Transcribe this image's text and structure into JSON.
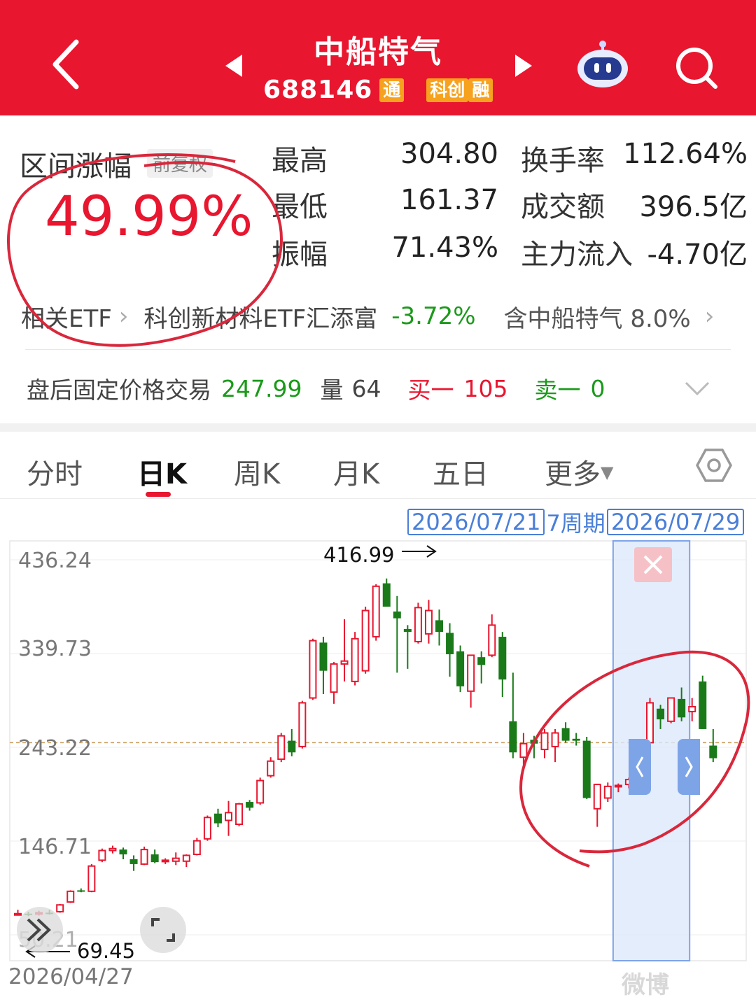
{
  "header": {
    "title": "中船特气",
    "code": "688146",
    "badges": [
      "通",
      "科创",
      "融"
    ]
  },
  "stats": {
    "range_label": "区间涨幅",
    "range_adjust": "前复权",
    "range_value": "49.99%",
    "items": [
      {
        "label": "最高",
        "value": "304.80"
      },
      {
        "label": "最低",
        "value": "161.37"
      },
      {
        "label": "振幅",
        "value": "71.43%"
      },
      {
        "label": "换手率",
        "value": "112.64%"
      },
      {
        "label": "成交额",
        "value": "396.5亿"
      },
      {
        "label": "主力流入",
        "value": "-4.70亿"
      }
    ]
  },
  "etf": {
    "label": "相关ETF",
    "name": "科创新材料ETF汇添富",
    "change": "-3.72%",
    "holding": "含中船特气 8.0%"
  },
  "after_hours": {
    "label": "盘后固定价格交易",
    "price": "247.99",
    "volume_label": "量",
    "volume": "64",
    "bid_label": "买一",
    "bid": "105",
    "ask_label": "卖一",
    "ask": "0"
  },
  "tabs": [
    "分时",
    "日K",
    "周K",
    "月K",
    "五日",
    "更多"
  ],
  "active_tab": "日K",
  "chart_period": {
    "start": "2026/07/21",
    "label": "7周期",
    "end": "2026/07/29"
  },
  "colors": {
    "up": "#e8162f",
    "down": "#1a7a1a",
    "header": "#e8162f",
    "highlight": "#dce8fb"
  },
  "chart_data": {
    "type": "candlestick",
    "y_ticks": [
      "436.24",
      "339.73",
      "243.22",
      "146.71",
      "50.21"
    ],
    "ylim": [
      50.21,
      436.24
    ],
    "start_date": "2026/04/27",
    "max_label": "416.99",
    "min_label": "69.45",
    "reference_line": 247.99,
    "highlight_range": [
      57,
      63
    ],
    "candles": [
      {
        "o": 72,
        "h": 76,
        "l": 70,
        "c": 72
      },
      {
        "o": 72,
        "h": 74,
        "l": 69.45,
        "c": 71
      },
      {
        "o": 72,
        "h": 75,
        "l": 70,
        "c": 73
      },
      {
        "o": 73,
        "h": 76,
        "l": 71,
        "c": 72
      },
      {
        "o": 74,
        "h": 82,
        "l": 73,
        "c": 81
      },
      {
        "o": 84,
        "h": 96,
        "l": 83,
        "c": 95
      },
      {
        "o": 96,
        "h": 98,
        "l": 94,
        "c": 95
      },
      {
        "o": 95,
        "h": 123,
        "l": 94,
        "c": 121
      },
      {
        "o": 127,
        "h": 139,
        "l": 125,
        "c": 137
      },
      {
        "o": 137,
        "h": 142,
        "l": 134,
        "c": 139
      },
      {
        "o": 138,
        "h": 140,
        "l": 128,
        "c": 133
      },
      {
        "o": 128,
        "h": 132,
        "l": 116,
        "c": 123
      },
      {
        "o": 123,
        "h": 141,
        "l": 122,
        "c": 138
      },
      {
        "o": 133,
        "h": 138,
        "l": 124,
        "c": 125
      },
      {
        "o": 126,
        "h": 129,
        "l": 123,
        "c": 127
      },
      {
        "o": 126,
        "h": 135,
        "l": 122,
        "c": 129
      },
      {
        "o": 126,
        "h": 133,
        "l": 120,
        "c": 132
      },
      {
        "o": 133,
        "h": 150,
        "l": 132,
        "c": 147
      },
      {
        "o": 149,
        "h": 173,
        "l": 147,
        "c": 171
      },
      {
        "o": 175,
        "h": 180,
        "l": 161,
        "c": 165
      },
      {
        "o": 168,
        "h": 188,
        "l": 152,
        "c": 176
      },
      {
        "o": 164,
        "h": 186,
        "l": 162,
        "c": 185
      },
      {
        "o": 187,
        "h": 189,
        "l": 178,
        "c": 181
      },
      {
        "o": 186,
        "h": 212,
        "l": 184,
        "c": 209
      },
      {
        "o": 214,
        "h": 233,
        "l": 212,
        "c": 229
      },
      {
        "o": 231,
        "h": 258,
        "l": 228,
        "c": 255
      },
      {
        "o": 250,
        "h": 262,
        "l": 234,
        "c": 238
      },
      {
        "o": 244,
        "h": 291,
        "l": 242,
        "c": 289
      },
      {
        "o": 294,
        "h": 355,
        "l": 292,
        "c": 353
      },
      {
        "o": 351,
        "h": 357,
        "l": 298,
        "c": 322
      },
      {
        "o": 300,
        "h": 331,
        "l": 288,
        "c": 329
      },
      {
        "o": 329,
        "h": 375,
        "l": 311,
        "c": 332
      },
      {
        "o": 311,
        "h": 362,
        "l": 307,
        "c": 355
      },
      {
        "o": 322,
        "h": 388,
        "l": 319,
        "c": 384
      },
      {
        "o": 357,
        "h": 411,
        "l": 353,
        "c": 409
      },
      {
        "o": 412,
        "h": 416.99,
        "l": 388,
        "c": 388
      },
      {
        "o": 383,
        "h": 399,
        "l": 320,
        "c": 376
      },
      {
        "o": 365,
        "h": 369,
        "l": 324,
        "c": 362
      },
      {
        "o": 352,
        "h": 392,
        "l": 350,
        "c": 387
      },
      {
        "o": 360,
        "h": 395,
        "l": 350,
        "c": 384
      },
      {
        "o": 374,
        "h": 385,
        "l": 348,
        "c": 362
      },
      {
        "o": 361,
        "h": 371,
        "l": 316,
        "c": 339
      },
      {
        "o": 342,
        "h": 348,
        "l": 300,
        "c": 306
      },
      {
        "o": 301,
        "h": 327,
        "l": 284,
        "c": 338
      },
      {
        "o": 336,
        "h": 342,
        "l": 309,
        "c": 328
      },
      {
        "o": 338,
        "h": 380,
        "l": 336,
        "c": 369
      },
      {
        "o": 357,
        "h": 362,
        "l": 295,
        "c": 313
      },
      {
        "o": 270,
        "h": 320,
        "l": 232,
        "c": 238
      },
      {
        "o": 233,
        "h": 258,
        "l": 219,
        "c": 247
      },
      {
        "o": 251,
        "h": 255,
        "l": 232,
        "c": 247
      },
      {
        "o": 241,
        "h": 262,
        "l": 232,
        "c": 258
      },
      {
        "o": 244,
        "h": 262,
        "l": 228,
        "c": 258
      },
      {
        "o": 263,
        "h": 269,
        "l": 248,
        "c": 250
      },
      {
        "o": 252,
        "h": 258,
        "l": 245,
        "c": 250
      },
      {
        "o": 250,
        "h": 254,
        "l": 190,
        "c": 191
      },
      {
        "o": 180,
        "h": 205,
        "l": 161.37,
        "c": 205
      },
      {
        "o": 191,
        "h": 207,
        "l": 187,
        "c": 203
      },
      {
        "o": 203,
        "h": 206,
        "l": 197,
        "c": 204
      },
      {
        "o": 205,
        "h": 212,
        "l": 201,
        "c": 210
      },
      {
        "o": 216,
        "h": 248,
        "l": 213,
        "c": 246
      },
      {
        "o": 248,
        "h": 294,
        "l": 246,
        "c": 289
      },
      {
        "o": 283,
        "h": 287,
        "l": 262,
        "c": 272
      },
      {
        "o": 270,
        "h": 294,
        "l": 268,
        "c": 294
      },
      {
        "o": 293,
        "h": 304.8,
        "l": 270,
        "c": 274
      },
      {
        "o": 280,
        "h": 294,
        "l": 270,
        "c": 285
      },
      {
        "o": 311,
        "h": 317,
        "l": 262,
        "c": 262
      },
      {
        "o": 245,
        "h": 262,
        "l": 228,
        "c": 232
      }
    ]
  },
  "watermark": "微博"
}
